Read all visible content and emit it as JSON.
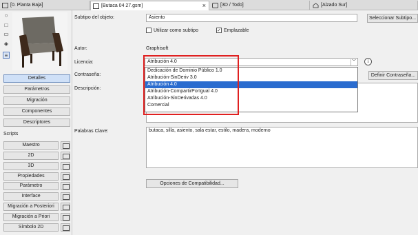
{
  "tabs": [
    {
      "label": "[0. Planta Baja]"
    },
    {
      "label": "[Butaca 04 27.gsm]"
    },
    {
      "label": "[3D / Todo]"
    },
    {
      "label": "[Alzado Sur]"
    }
  ],
  "left": {
    "buttons": [
      "Detalles",
      "Parámetros",
      "Migración",
      "Componentes",
      "Descriptores"
    ],
    "scripts_label": "Scripts",
    "scripts": [
      "Maestro",
      "2D",
      "3D",
      "Propiedades",
      "Parámetro",
      "Interface",
      "Migración a Posteriori",
      "Migración a Priori",
      "Símbolo 2D"
    ]
  },
  "form": {
    "subtype_label": "Subtipo del objeto:",
    "subtype_value": "Asiento",
    "select_subtype_btn": "Seleccionar Subtipo...",
    "use_as_subtype": "Utilizar como subtipo",
    "placeable": "Emplazable",
    "author_label": "Autor:",
    "author_value": "Graphisoft",
    "license_label": "Licencia:",
    "license_value": "Atribución 4.0",
    "password_label": "Contraseña:",
    "define_password_btn": "Definir Contraseña...",
    "description_label": "Descripción:",
    "keywords_label": "Palabras Clave:",
    "keywords_value": "butaca, silla, asiento, sala estar, estilo, madera, moderno",
    "compat_btn": "Opciones de Compatibilidad..."
  },
  "license_options": [
    "Dedicación de Dominio Público 1.0",
    "Atribución-SinDeriv 3.0",
    "Atribución 4.0",
    "Atribución-CompartirPorIgual 4.0",
    "Atribución-SinDerivadas 4.0",
    "Comercial"
  ],
  "license_selected_index": 2,
  "colors": {
    "accent": "#2a6ccf",
    "highlight": "#e02020"
  }
}
